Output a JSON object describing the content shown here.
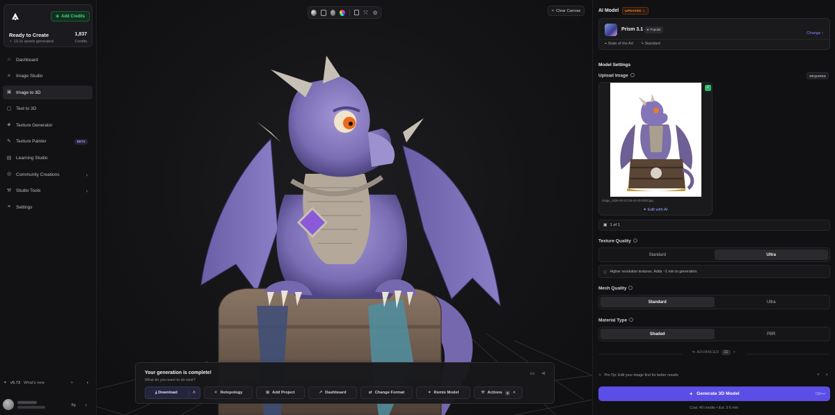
{
  "sidebar": {
    "add_credits": "Add Credits",
    "ready": "Ready to Create",
    "assets": "13.1k assets generated",
    "credit_count": "1,837",
    "credit_label": "Credits",
    "items": [
      {
        "label": "Dashboard",
        "icon": "home-icon"
      },
      {
        "label": "Image Studio",
        "icon": "image-studio-icon"
      },
      {
        "label": "Image to 3D",
        "icon": "cube-image-icon"
      },
      {
        "label": "Text to 3D",
        "icon": "text-3d-icon"
      },
      {
        "label": "Texture Generator",
        "icon": "texture-icon"
      },
      {
        "label": "Texture Painter",
        "icon": "brush-icon",
        "badge": "BETA"
      },
      {
        "label": "Learning Studio",
        "icon": "book-icon"
      },
      {
        "label": "Community Creations",
        "icon": "globe-icon"
      },
      {
        "label": "Studio Tools",
        "icon": "tools-icon"
      },
      {
        "label": "Settings",
        "icon": "sliders-icon"
      }
    ],
    "active_index": 2,
    "version": "v5.73",
    "whats_new": "What's new"
  },
  "canvas": {
    "clear_canvas": "Clear Canvas",
    "gen_title": "Your generation is complete!",
    "gen_sub": "What do you want to do next?",
    "actions": {
      "download": "Download",
      "retopology": "Retopology",
      "add_project": "Add Project",
      "dashboard": "Dashboard",
      "change_format": "Change Format",
      "remix_model": "Remix Model",
      "actions": "Actions",
      "actions_count": "8"
    },
    "colors": {
      "dragon": "#8e82c4",
      "chest": "#7a6656",
      "accent": "#5b4ee6"
    }
  },
  "right": {
    "ai_model": "AI Model",
    "updated": "UPDATED",
    "model_name": "Prism 3.1",
    "popular": "Popular",
    "change": "Change",
    "tag1": "State of the Art",
    "tag2": "Standard",
    "model_settings": "Model Settings",
    "upload_image": "Upload Image",
    "required": "REQUIRED",
    "file_name": "image_2026-05-21T19-41-00-8262.jpg",
    "edit_ai": "Edit with AI",
    "pager": "1 of 1",
    "texture_quality": "Texture Quality",
    "tq_options": [
      "Standard",
      "Ultra"
    ],
    "tq_selected": 1,
    "texture_hint": "Higher resolution textures. Adds ~1 min to generation.",
    "mesh_quality": "Mesh Quality",
    "mq_options": [
      "Standard",
      "Ultra"
    ],
    "mq_selected": 0,
    "material_type": "Material Type",
    "mt_options": [
      "Shaded",
      "PBR"
    ],
    "mt_selected": 0,
    "advanced": "ADVANCED",
    "advanced_count": "11",
    "protip": "Pro Tip: Edit your image first for better results",
    "generate": "Generate 3D Model",
    "shortcut": "Ctrl+↵",
    "cost": "Cost: 40 credits • Est. 3-5 min"
  }
}
